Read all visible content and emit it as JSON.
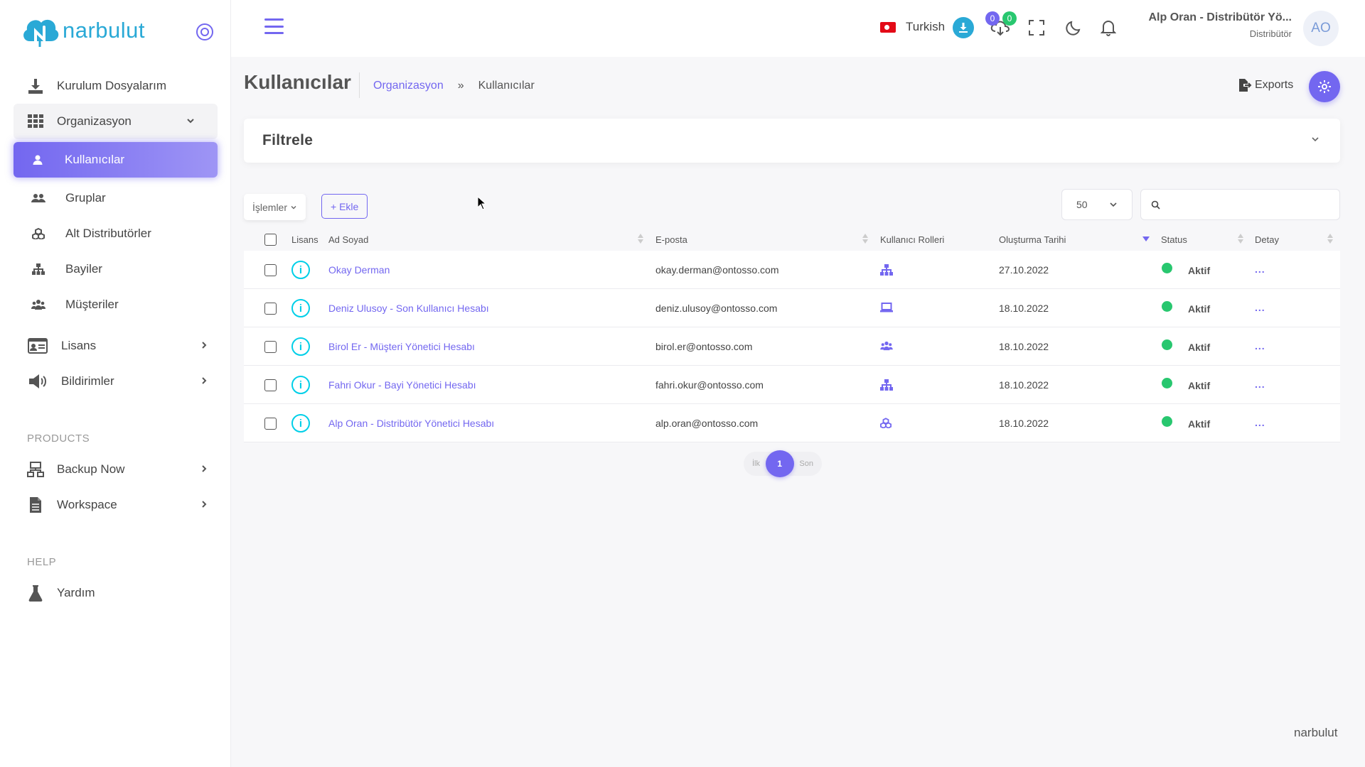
{
  "app": {
    "logo_text": "narbulut",
    "footer_brand": "narbulut"
  },
  "sidebar": {
    "items": [
      {
        "label": "Kurulum Dosyalarım",
        "icon": "download-tray-icon"
      },
      {
        "label": "Organizasyon",
        "icon": "grid-icon",
        "expanded": true
      },
      {
        "label": "Lisans",
        "icon": "id-card-icon"
      },
      {
        "label": "Bildirimler",
        "icon": "megaphone-icon"
      }
    ],
    "org_children": [
      {
        "label": "Kullanıcılar",
        "icon": "user-icon",
        "active": true
      },
      {
        "label": "Gruplar",
        "icon": "users-icon"
      },
      {
        "label": "Alt Distributörler",
        "icon": "cubes-icon"
      },
      {
        "label": "Bayiler",
        "icon": "sitemap-icon"
      },
      {
        "label": "Müşteriler",
        "icon": "user-group-icon"
      }
    ],
    "products_title": "PRODUCTS",
    "products": [
      {
        "label": "Backup Now",
        "icon": "network-icon"
      },
      {
        "label": "Workspace",
        "icon": "document-icon"
      }
    ],
    "help_title": "HELP",
    "help": [
      {
        "label": "Yardım",
        "icon": "flask-icon"
      }
    ]
  },
  "header": {
    "language": "Turkish",
    "badge_left": "0",
    "badge_right": "0",
    "user_name": "Alp Oran - Distribütör Yö...",
    "user_role": "Distribütör",
    "avatar_initials": "AO"
  },
  "page": {
    "title": "Kullanıcılar",
    "breadcrumb_parent": "Organizasyon",
    "breadcrumb_sep": "»",
    "breadcrumb_current": "Kullanıcılar",
    "exports_label": "Exports",
    "filter_title": "Filtrele"
  },
  "toolbar": {
    "actions_label": "İşlemler",
    "add_label": "+ Ekle",
    "page_size": "50",
    "search_value": ""
  },
  "table": {
    "headers": {
      "license": "Lisans",
      "name": "Ad Soyad",
      "email": "E-posta",
      "roles": "Kullanıcı Rolleri",
      "created": "Oluşturma Tarihi",
      "status": "Status",
      "detail": "Detay"
    },
    "rows": [
      {
        "name": "Okay Derman",
        "email": "okay.derman@ontosso.com",
        "role_icon": "sitemap-icon",
        "created": "27.10.2022",
        "status": "Aktif",
        "detail": "..."
      },
      {
        "name": "Deniz Ulusoy - Son Kullanıcı Hesabı",
        "email": "deniz.ulusoy@ontosso.com",
        "role_icon": "laptop-icon",
        "created": "18.10.2022",
        "status": "Aktif",
        "detail": "..."
      },
      {
        "name": "Birol Er - Müşteri Yönetici Hesabı",
        "email": "birol.er@ontosso.com",
        "role_icon": "user-group-icon",
        "created": "18.10.2022",
        "status": "Aktif",
        "detail": "..."
      },
      {
        "name": "Fahri Okur - Bayi Yönetici Hesabı",
        "email": "fahri.okur@ontosso.com",
        "role_icon": "sitemap-icon",
        "created": "18.10.2022",
        "status": "Aktif",
        "detail": "..."
      },
      {
        "name": "Alp Oran - Distribütör Yönetici Hesabı",
        "email": "alp.oran@ontosso.com",
        "role_icon": "cubes-icon",
        "created": "18.10.2022",
        "status": "Aktif",
        "detail": "..."
      }
    ]
  },
  "pagination": {
    "first": "İlk",
    "current": "1",
    "last": "Son"
  },
  "colors": {
    "primary": "#7367f0",
    "info": "#00cfe8",
    "success": "#28c76f",
    "brand": "#2aa9d6"
  }
}
